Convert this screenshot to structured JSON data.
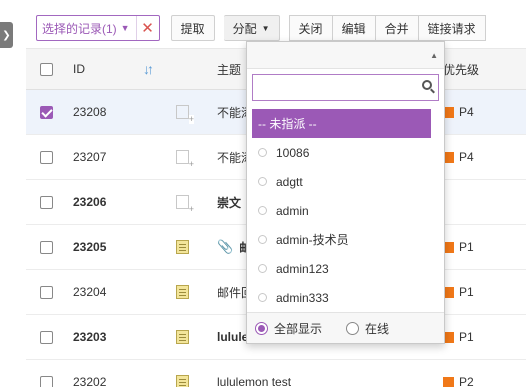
{
  "toolbar": {
    "selected_records": "选择的记录(1)",
    "extract": "提取",
    "assign": "分配",
    "close": "关闭",
    "edit": "编辑",
    "merge": "合并",
    "link_request": "链接请求"
  },
  "table": {
    "headers": {
      "id": "ID",
      "subject": "主题",
      "priority": "优先级"
    },
    "rows": [
      {
        "id": "23208",
        "subject": "不能添加用户",
        "priority": "P4",
        "checked": true,
        "bold": false,
        "note": false
      },
      {
        "id": "23207",
        "subject": "不能添加用户",
        "priority": "P4",
        "checked": false,
        "bold": false,
        "note": false
      },
      {
        "id": "23206",
        "subject": "崇文",
        "priority": "",
        "checked": false,
        "bold": true,
        "note": false
      },
      {
        "id": "23205",
        "subject": "邮件",
        "priority": "P1",
        "checked": false,
        "bold": true,
        "note": true
      },
      {
        "id": "23204",
        "subject": "邮件回复",
        "priority": "P1",
        "checked": false,
        "bold": false,
        "note": true
      },
      {
        "id": "23203",
        "subject": "lululemon",
        "priority": "P1",
        "checked": false,
        "bold": true,
        "note": true
      },
      {
        "id": "23202",
        "subject": "lululemon test",
        "priority": "P2",
        "checked": false,
        "bold": false,
        "note": true
      }
    ]
  },
  "dropdown": {
    "search_placeholder": "",
    "unassigned": "-- 未指派 --",
    "users": [
      "10086",
      "adgtt",
      "admin",
      "admin-技术员",
      "admin123",
      "admin333"
    ],
    "show_all": "全部显示",
    "online": "在线"
  },
  "colors": {
    "accent": "#9b59b6",
    "priority": "#f07818"
  }
}
